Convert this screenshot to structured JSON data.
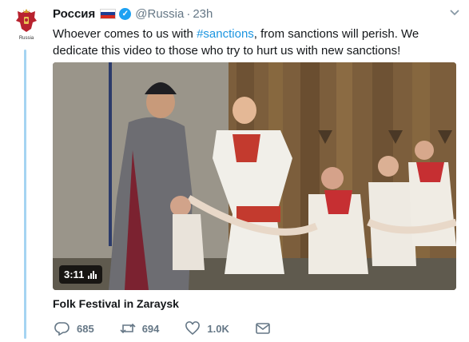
{
  "tweet": {
    "avatar_text": "Russia",
    "display_name": "Россия",
    "flag_icon": "russian-flag-icon",
    "handle": "@Russia",
    "separator": "·",
    "time": "23h",
    "text_before": "Whoever comes to us with ",
    "hashtag": "#sanctions",
    "text_after": ", from sanctions will perish. We dedicate this video to those who try to hurt us with new sanctions!",
    "hashtag_color": "#1b95e0",
    "thread_line_color": "#a5d4f2"
  },
  "media": {
    "duration": "3:11",
    "title": "Folk Festival in Zaraysk"
  },
  "actions": {
    "replies": "685",
    "retweets": "694",
    "likes": "1.0K"
  }
}
